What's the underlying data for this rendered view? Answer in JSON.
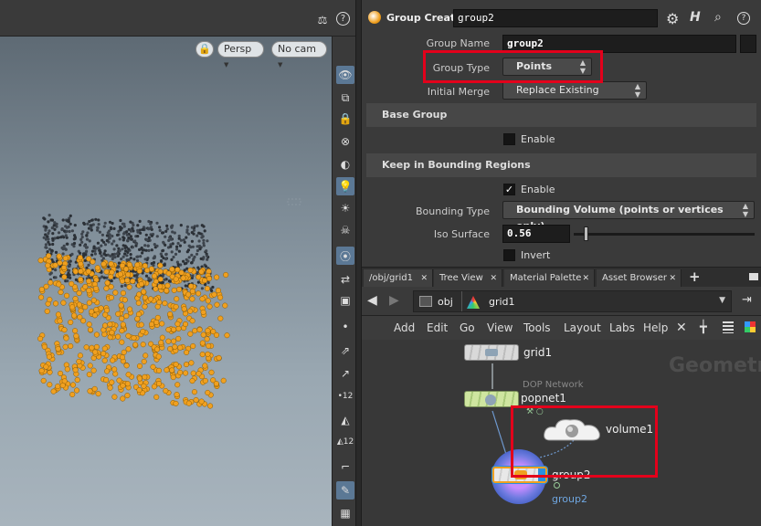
{
  "viewport": {
    "camera_label": "Persp",
    "cam_label": "No cam",
    "help_glyph": "?"
  },
  "params": {
    "node_type": "Group Create",
    "node_name": "group2",
    "group_name_label": "Group Name",
    "group_name_value": "group2",
    "group_type_label": "Group Type",
    "group_type_value": "Points",
    "initial_merge_label": "Initial Merge",
    "initial_merge_value": "Replace Existing",
    "base_group_title": "Base Group",
    "base_group_enable_label": "Enable",
    "bounding_title": "Keep in Bounding Regions",
    "bounding_enable_label": "Enable",
    "bounding_type_label": "Bounding Type",
    "bounding_type_value": "Bounding Volume (points or vertices only)",
    "iso_surface_label": "Iso Surface",
    "iso_surface_value": "0.56",
    "iso_surface_slider_fraction": 0.056,
    "invert_label": "Invert",
    "base_group_enabled": false,
    "bounding_enabled": true,
    "invert_enabled": false
  },
  "tabs": [
    {
      "label": "/obj/grid1"
    },
    {
      "label": "Tree View"
    },
    {
      "label": "Material Palette"
    },
    {
      "label": "Asset Browser"
    }
  ],
  "tab_add_glyph": "+",
  "path": {
    "obj_label": "obj",
    "grid_label": "grid1"
  },
  "network_menu": [
    "Add",
    "Edit",
    "Go",
    "View",
    "Tools",
    "Layout",
    "Labs",
    "Help"
  ],
  "network": {
    "context_watermark": "Geometr",
    "nodes": {
      "grid1": "grid1",
      "dop_caption": "DOP Network",
      "popnet1": "popnet1",
      "volume1": "volume1",
      "group2": "group2",
      "group2_subtitle": "group2"
    }
  },
  "colors": {
    "highlight_red": "#e3001b",
    "selected_node": "#cfe6a0",
    "particle_orange": "#f0a020",
    "accent_blue": "#5b7895"
  }
}
